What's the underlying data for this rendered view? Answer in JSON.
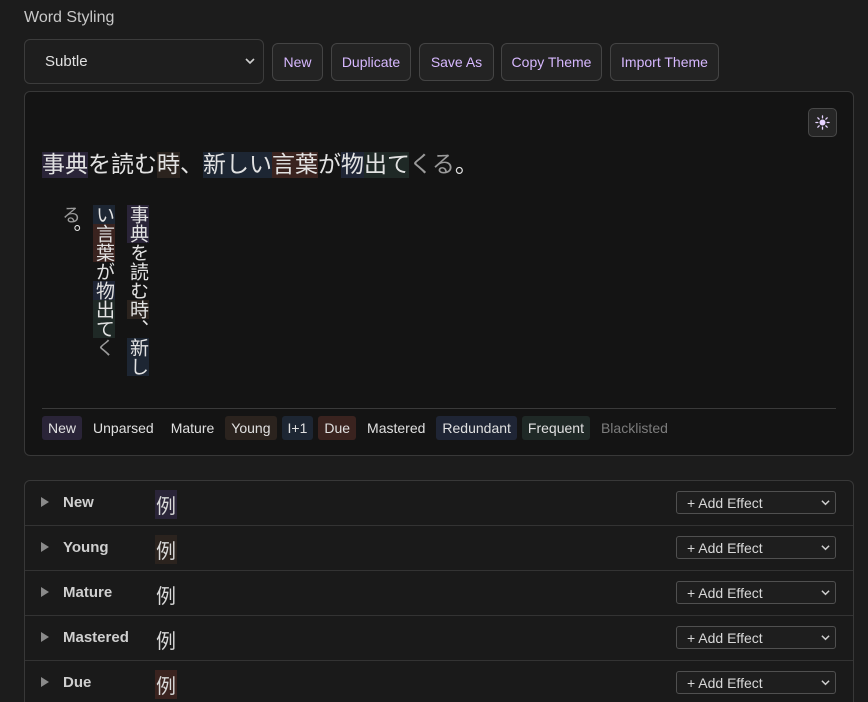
{
  "section_title": "Word Styling",
  "theme_select": {
    "value": "Subtle"
  },
  "toolbar": {
    "new_label": "New",
    "duplicate_label": "Duplicate",
    "save_as_label": "Save As",
    "copy_theme_label": "Copy Theme",
    "import_theme_label": "Import Theme"
  },
  "preview": {
    "toggle_icon": "sun-icon",
    "words": [
      {
        "text": "事典",
        "status": "new"
      },
      {
        "text": "を",
        "status": "mature"
      },
      {
        "text": "読む",
        "status": "mature"
      },
      {
        "text": "時",
        "status": "young"
      },
      {
        "text": "、",
        "status": "mature"
      },
      {
        "text": "新しい",
        "status": "ip1"
      },
      {
        "text": "言葉",
        "status": "due"
      },
      {
        "text": "が",
        "status": "mature"
      },
      {
        "text": "物",
        "status": "redundant"
      },
      {
        "text": "出",
        "status": "frequent"
      },
      {
        "text": "て",
        "status": "frequent"
      },
      {
        "text": "くる",
        "status": "unparsed"
      },
      {
        "text": "。",
        "status": "mature"
      }
    ]
  },
  "legend": {
    "new": "New",
    "unparsed": "Unparsed",
    "mature": "Mature",
    "young": "Young",
    "ip1": "I+1",
    "due": "Due",
    "mastered": "Mastered",
    "redundant": "Redundant",
    "frequent": "Frequent",
    "blacklisted": "Blacklisted"
  },
  "effects": {
    "sample_char": "例",
    "add_effect_label": "+ Add Effect",
    "rows": [
      {
        "label": "New",
        "status": "new"
      },
      {
        "label": "Young",
        "status": "young"
      },
      {
        "label": "Mature",
        "status": "mature"
      },
      {
        "label": "Mastered",
        "status": "mature"
      },
      {
        "label": "Due",
        "status": "due"
      }
    ]
  },
  "colors": {
    "accent": "#d7b8ff",
    "new_bg": "#2a2438",
    "young_bg": "#2b231e",
    "ip1_bg": "#1d2633",
    "due_bg": "#3a231f",
    "redundant_bg": "#1f2535",
    "frequent_bg": "#1f2926"
  }
}
